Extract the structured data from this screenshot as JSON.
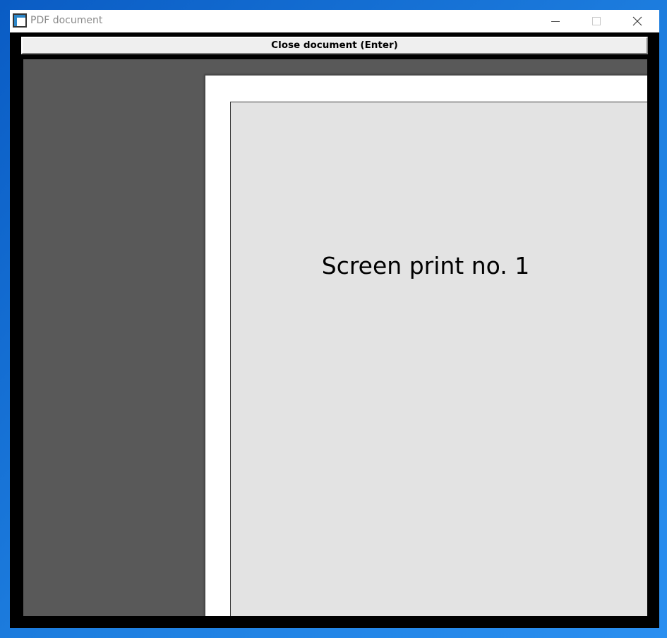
{
  "window": {
    "title": "PDF document",
    "icon": "app-window-icon",
    "controls": {
      "minimize_icon": "minimize-icon",
      "maximize_icon": "maximize-icon",
      "close_icon": "close-icon"
    }
  },
  "toolbar": {
    "close_document_label": "Close document (Enter)"
  },
  "document": {
    "page_text": "Screen print no. 1"
  },
  "colors": {
    "desktop": "#1e7fe0",
    "viewer_background": "#595959",
    "page": "#ffffff",
    "screenshot_fill": "#e3e3e3"
  }
}
